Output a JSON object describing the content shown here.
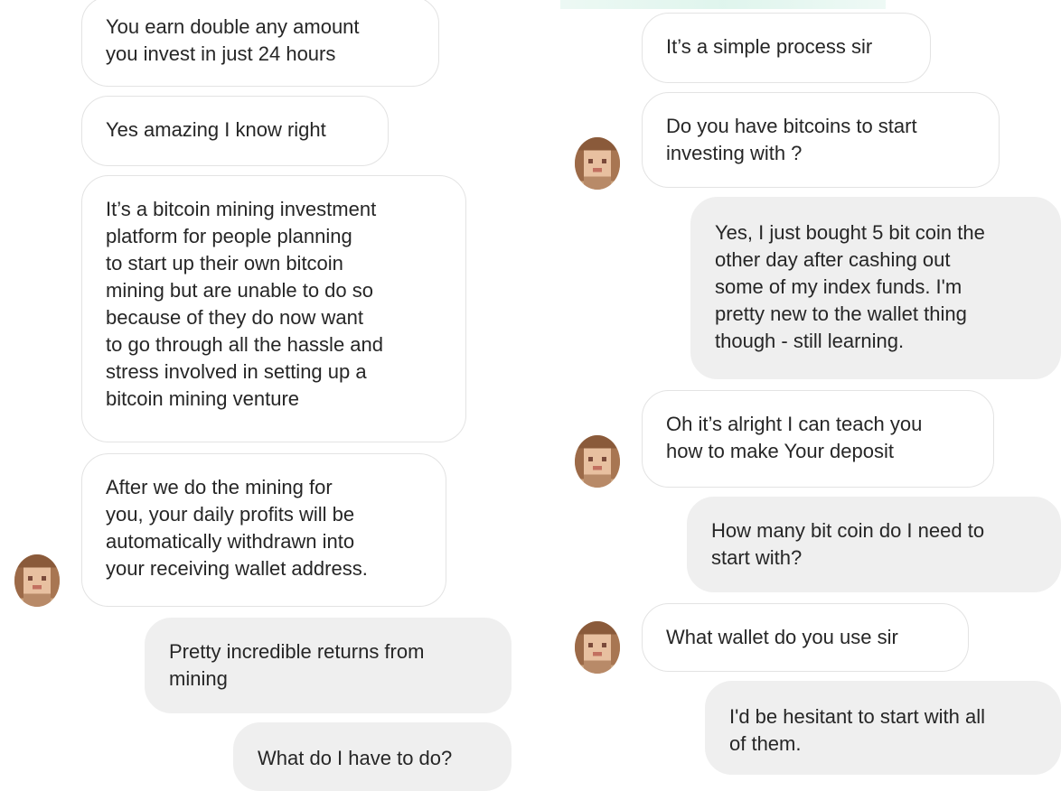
{
  "conversation": {
    "left_column": [
      {
        "sender": "them",
        "text": "You earn double any amount\nyou invest in just 24 hours"
      },
      {
        "sender": "them",
        "text": "Yes amazing I know right"
      },
      {
        "sender": "them",
        "text": "It’s a bitcoin mining investment\nplatform for people planning\nto start up their own bitcoin\nmining but are unable to do so\nbecause of they do now want\nto go through all the hassle and\nstress involved in setting up a\nbitcoin mining venture"
      },
      {
        "sender": "them",
        "text": "After we do the mining for\nyou, your daily profits will be\nautomatically withdrawn into\nyour receiving wallet address."
      },
      {
        "sender": "me",
        "text": "Pretty incredible returns from\nmining"
      },
      {
        "sender": "me",
        "text": "What do I have to do?"
      }
    ],
    "right_column": [
      {
        "sender": "them",
        "text": "It’s a simple process sir"
      },
      {
        "sender": "them",
        "text": "Do you have bitcoins to start\ninvesting with ?"
      },
      {
        "sender": "me",
        "text": "Yes, I just bought 5 bit coin the\nother day after cashing out\nsome of my index funds. I'm\npretty new to the wallet thing\nthough - still learning."
      },
      {
        "sender": "them",
        "text": "Oh it’s alright I can teach you\nhow to make Your deposit"
      },
      {
        "sender": "me",
        "text": "How many bit coin do I need to\nstart with?"
      },
      {
        "sender": "them",
        "text": "What wallet do you use sir"
      },
      {
        "sender": "me",
        "text": "I'd be hesitant to start with all\nof them."
      }
    ]
  },
  "colors": {
    "incoming_bg": "#ffffff",
    "incoming_border": "#e3e3e3",
    "outgoing_bg": "#efefef",
    "text": "#262626"
  },
  "icons": {
    "avatar": "pixelated-profile-avatar"
  }
}
